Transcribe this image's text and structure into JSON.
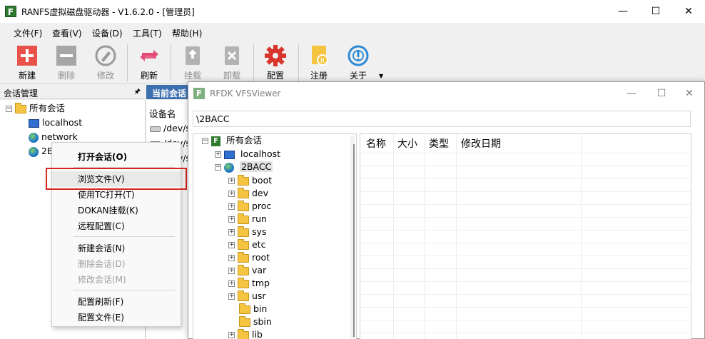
{
  "app": {
    "title": "RANFS虚拟磁盘驱动器 - V1.6.2.0 - [管理员]",
    "logo_letter": "F"
  },
  "menus": [
    "文件(F)",
    "查看(V)",
    "设备(D)",
    "工具(T)",
    "帮助(H)"
  ],
  "toolbar": {
    "buttons": [
      {
        "label": "新建",
        "icon": "new-plus-icon",
        "enabled": true
      },
      {
        "label": "删除",
        "icon": "delete-minus-icon",
        "enabled": false
      },
      {
        "label": "修改",
        "icon": "edit-icon",
        "enabled": false
      },
      {
        "label": "刷新",
        "icon": "refresh-icon",
        "enabled": true
      },
      {
        "label": "挂载",
        "icon": "mount-icon",
        "enabled": false
      },
      {
        "label": "卸载",
        "icon": "unmount-icon",
        "enabled": false
      },
      {
        "label": "配置",
        "icon": "gear-icon",
        "enabled": true
      },
      {
        "label": "注册",
        "icon": "register-icon",
        "enabled": true
      },
      {
        "label": "关于",
        "icon": "about-icon",
        "enabled": true
      }
    ]
  },
  "session_panel": {
    "title": "会话管理",
    "pin": "🖈",
    "root": "所有会话",
    "items": [
      "localhost",
      "network",
      "2BACC"
    ]
  },
  "current_pane": {
    "tab": "当前会话",
    "column": "设备名",
    "rows": [
      "/dev/s",
      "/dev/s",
      "/dev/s"
    ]
  },
  "context_menu": {
    "items": [
      {
        "label": "打开会话(O)",
        "bold": true,
        "disabled": false
      },
      {
        "label": "浏览文件(V)",
        "bold": false,
        "disabled": false,
        "hover": true
      },
      {
        "label": "使用TC打开(T)",
        "bold": false,
        "disabled": false
      },
      {
        "label": "DOKAN挂载(K)",
        "bold": false,
        "disabled": false
      },
      {
        "label": "远程配置(C)",
        "bold": false,
        "disabled": false
      },
      {
        "label": "新建会话(N)",
        "bold": false,
        "disabled": false
      },
      {
        "label": "删除会话(D)",
        "bold": false,
        "disabled": true
      },
      {
        "label": "修改会话(M)",
        "bold": false,
        "disabled": true
      },
      {
        "label": "配置刷新(F)",
        "bold": false,
        "disabled": false
      },
      {
        "label": "配置文件(E)",
        "bold": false,
        "disabled": false
      }
    ]
  },
  "vfs_viewer": {
    "title": "RFDK VFSViewer",
    "logo_letter": "F",
    "path": "\\2BACC",
    "tree_root": "所有会话",
    "hosts": [
      "localhost",
      "2BACC"
    ],
    "folders": [
      "boot",
      "dev",
      "proc",
      "run",
      "sys",
      "etc",
      "root",
      "var",
      "tmp",
      "usr",
      "bin",
      "sbin",
      "lib"
    ],
    "columns": [
      "名称",
      "大小",
      "类型",
      "修改日期"
    ]
  },
  "colors": {
    "accent_tab": "#3c6fae",
    "highlight_border": "#d9261c",
    "gear": "#d9342b",
    "refresh": "#e24a76",
    "register": "#f5c542",
    "about": "#2f8ad6"
  }
}
